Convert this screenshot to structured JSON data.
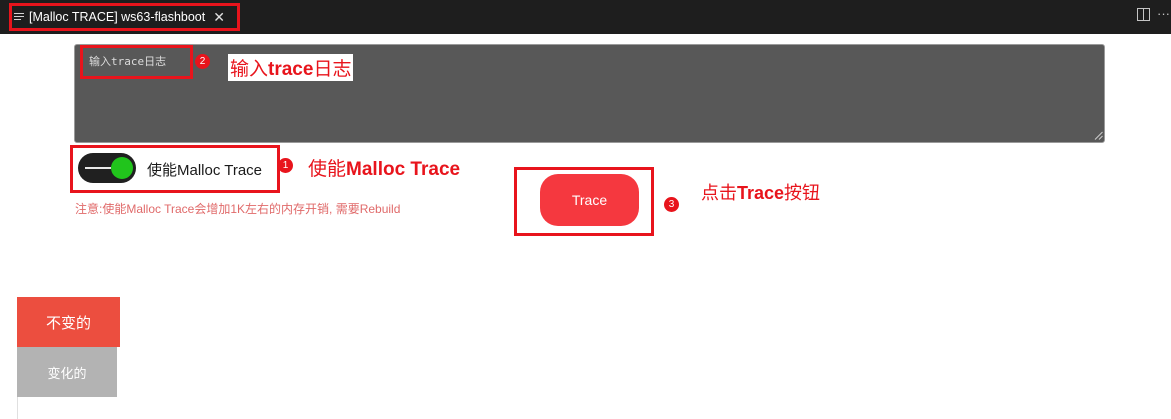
{
  "tab": {
    "title": "[Malloc TRACE] ws63-flashboot",
    "close_icon": "close-icon",
    "menu_icon": "list-lines-icon"
  },
  "titlebar_actions": {
    "split_icon": "split-editor-icon",
    "more": "···"
  },
  "log_input": {
    "placeholder": "输入trace日志",
    "value": ""
  },
  "toggle": {
    "state": "on",
    "label": "使能Malloc Trace"
  },
  "note": "注意:使能Malloc Trace会增加1K左右的内存开销, 需要Rebuild",
  "trace_button": {
    "label": "Trace"
  },
  "side_tabs": [
    {
      "label": "不变的",
      "active": true
    },
    {
      "label": "变化的",
      "active": false
    }
  ],
  "annotations": [
    {
      "number": "1",
      "text_prefix": "使能",
      "text_main": "Malloc Trace"
    },
    {
      "number": "2",
      "text_prefix": "输入",
      "text_main": "trace",
      "text_suffix": "日志"
    },
    {
      "number": "3",
      "text_prefix": "点击",
      "text_main": "Trace",
      "text_suffix": "按钮"
    }
  ],
  "colors": {
    "annotation_red": "#e8141c",
    "trace_button": "#f5383f",
    "toggle_on": "#21c41c",
    "tab_active": "#ec4e3f",
    "tab_inactive": "#b3b3b3",
    "textarea_bg": "#585858",
    "titlebar_bg": "#1e1e1e"
  }
}
